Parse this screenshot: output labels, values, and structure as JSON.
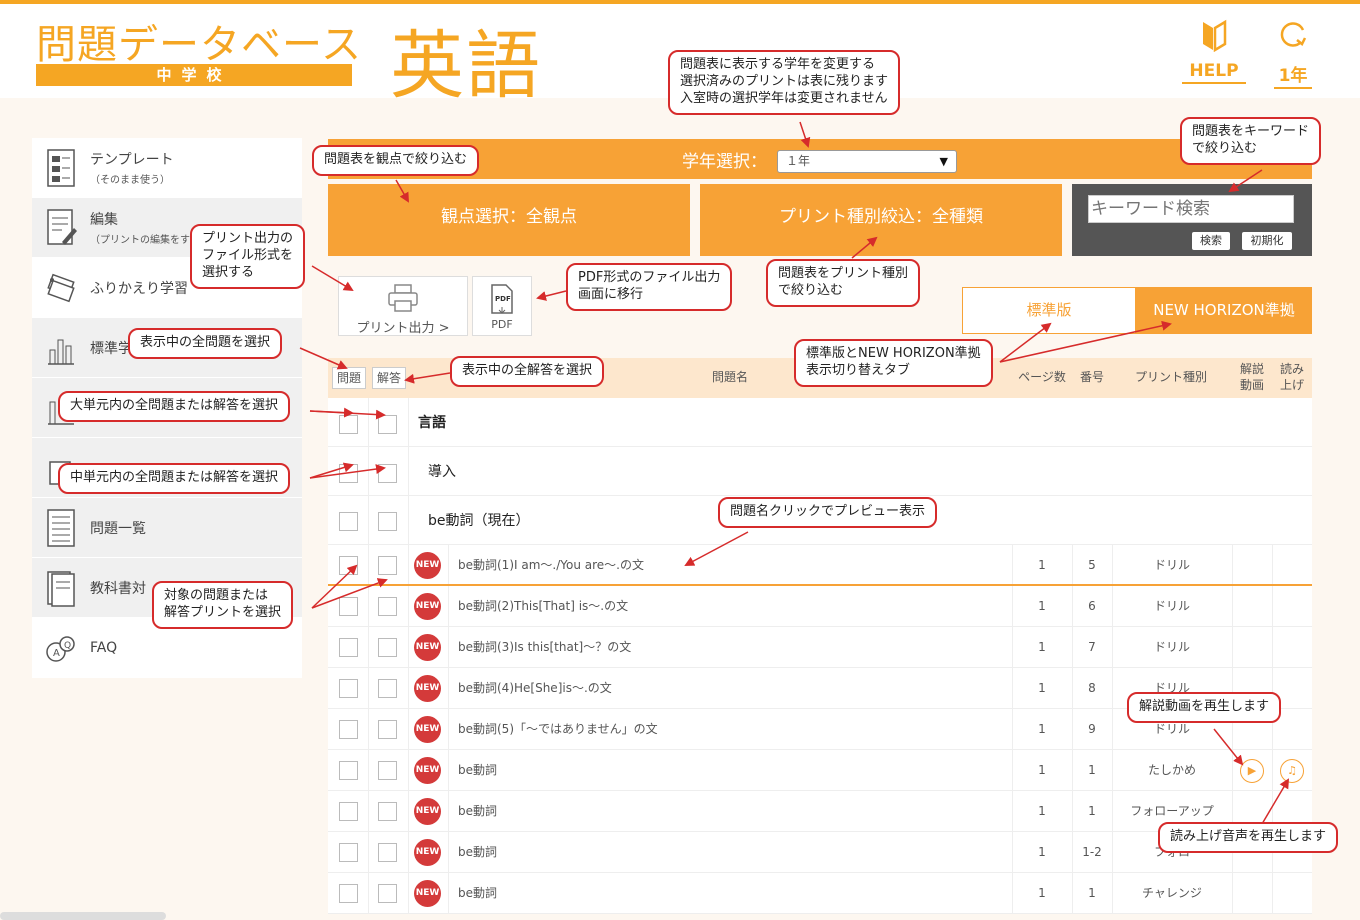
{
  "header": {
    "logo_main": "問題データベース",
    "logo_sub": "中学校",
    "subject": "英語",
    "help_label": "HELP",
    "year_label": "1年"
  },
  "sidebar": {
    "items": [
      {
        "label": "テンプレート",
        "sub": "（そのまま使う）"
      },
      {
        "label": "編集",
        "sub": "（プリントの編集をす"
      },
      {
        "label": "ふりかえり学習",
        "sub": ""
      },
      {
        "label": "標準学",
        "sub": ""
      },
      {
        "label": "",
        "sub": ""
      },
      {
        "label": "",
        "sub": ""
      },
      {
        "label": "問題一覧",
        "sub": ""
      },
      {
        "label": "教科書対",
        "sub": ""
      },
      {
        "label": "FAQ",
        "sub": ""
      }
    ]
  },
  "grade": {
    "label": "学年選択：",
    "value": "１年"
  },
  "filters": {
    "viewpoint": "観点選択：全観点",
    "print_type": "プリント種別絞込：全種類"
  },
  "keyword": {
    "placeholder": "キーワード検索",
    "search": "検索",
    "reset": "初期化"
  },
  "actions": {
    "print": "プリント出力 >",
    "pdf_icon": "PDF",
    "pdf": "PDF"
  },
  "tabs": {
    "standard": "標準版",
    "new_horizon": "NEW HORIZON準拠"
  },
  "table": {
    "headers": {
      "question_btn": "問題",
      "answer_btn": "解答",
      "name": "問題名",
      "page": "ページ数",
      "number": "番号",
      "type": "プリント種別",
      "video": "解説\n動画",
      "read": "読み\n上げ"
    },
    "groups": [
      {
        "label": "言語"
      },
      {
        "label": "導入"
      },
      {
        "label": "be動詞（現在）"
      }
    ],
    "rows": [
      {
        "badge": "NEW",
        "name": "be動詞(1)I am～./You are～.の文",
        "page": "1",
        "number": "5",
        "type": "ドリル"
      },
      {
        "badge": "NEW",
        "name": "be動詞(2)This[That] is～.の文",
        "page": "1",
        "number": "6",
        "type": "ドリル"
      },
      {
        "badge": "NEW",
        "name": "be動詞(3)Is this[that]～？の文",
        "page": "1",
        "number": "7",
        "type": "ドリル"
      },
      {
        "badge": "NEW",
        "name": "be動詞(4)He[She]is～.の文",
        "page": "1",
        "number": "8",
        "type": "ドリル"
      },
      {
        "badge": "NEW",
        "name": "be動詞(5)「～ではありません」の文",
        "page": "1",
        "number": "9",
        "type": "ドリル"
      },
      {
        "badge": "NEW",
        "name": "be動詞",
        "page": "1",
        "number": "1",
        "type": "たしかめ"
      },
      {
        "badge": "NEW",
        "name": "be動詞",
        "page": "1",
        "number": "1",
        "type": "フォローアップ"
      },
      {
        "badge": "NEW",
        "name": "be動詞",
        "page": "1",
        "number": "1-2",
        "type": "フォロ"
      },
      {
        "badge": "NEW",
        "name": "be動詞",
        "page": "1",
        "number": "1",
        "type": "チャレンジ"
      }
    ]
  },
  "callouts": {
    "grade_change": "問題表に表示する学年を変更する\n選択済みのプリントは表に残ります\n入室時の選択学年は変更されません",
    "keyword": "問題表をキーワード\nで絞り込む",
    "viewpoint": "問題表を観点で絞り込む",
    "print_format": "プリント出力の\nファイル形式を\n選択する",
    "pdf": "PDF形式のファイル出力\n画面に移行",
    "print_type": "問題表をプリント種別\nで絞り込む",
    "select_all_q": "表示中の全問題を選択",
    "select_all_a": "表示中の全解答を選択",
    "tab_switch": "標準版とNEW HORIZON準拠\n表示切り替えタブ",
    "big_unit": "大単元内の全問題または解答を選択",
    "mid_unit": "中単元内の全問題または解答を選択",
    "preview": "問題名クリックでプレビュー表示",
    "target": "対象の問題または\n解答プリントを選択",
    "video": "解説動画を再生します",
    "read": "読み上げ音声を再生します"
  },
  "colors": {
    "accent": "#f7a236",
    "logo": "#f5a623",
    "badge": "#d43a3a",
    "callout_border": "#d62b2b"
  }
}
